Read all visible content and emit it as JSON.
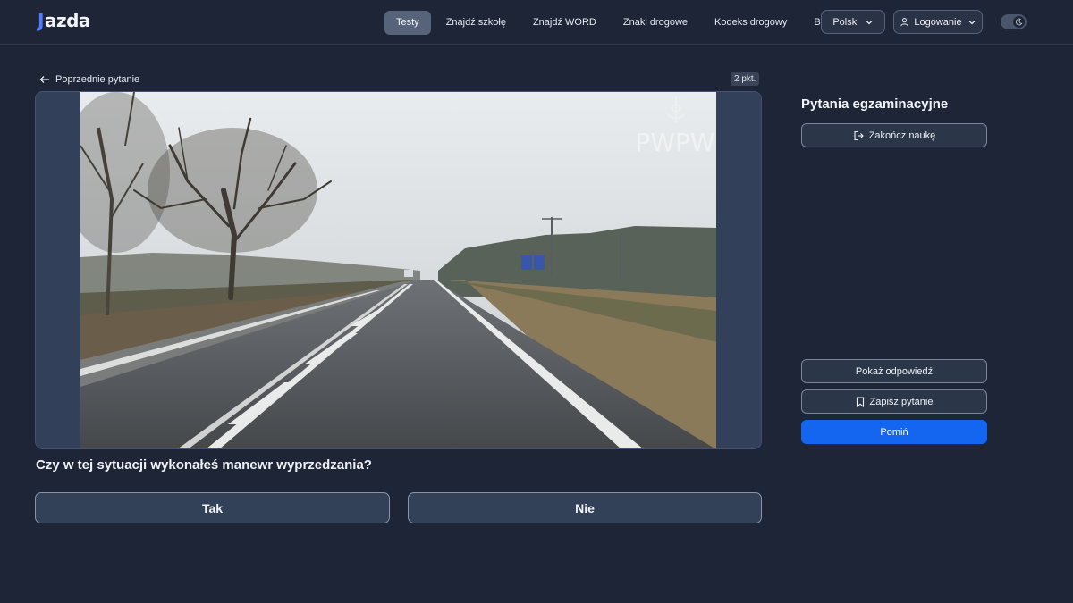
{
  "header": {
    "logo_mark": "J",
    "logo_text": "azda",
    "nav": [
      {
        "label": "Testy",
        "active": true
      },
      {
        "label": "Znajdź szkołę"
      },
      {
        "label": "Znajdź WORD"
      },
      {
        "label": "Znaki drogowe"
      },
      {
        "label": "Kodeks drogowy"
      },
      {
        "label": "Blog"
      }
    ],
    "language": "Polski",
    "login": "Logowanie"
  },
  "main": {
    "back_label": "Poprzednie pytanie",
    "points": "2 pkt.",
    "watermark": "PWPW",
    "question": "Czy w tej sytuacji wykonałeś manewr wyprzedzania?",
    "answers": [
      "Tak",
      "Nie"
    ]
  },
  "sidebar": {
    "title": "Pytania egzaminacyjne",
    "end_label": "Zakończ naukę",
    "show_answer_label": "Pokaż odpowiedź",
    "save_label": "Zapisz pytanie",
    "skip_label": "Pomiń"
  },
  "colors": {
    "background": "#1d2536",
    "primary": "#1466f0",
    "accent": "#4f7cff"
  }
}
